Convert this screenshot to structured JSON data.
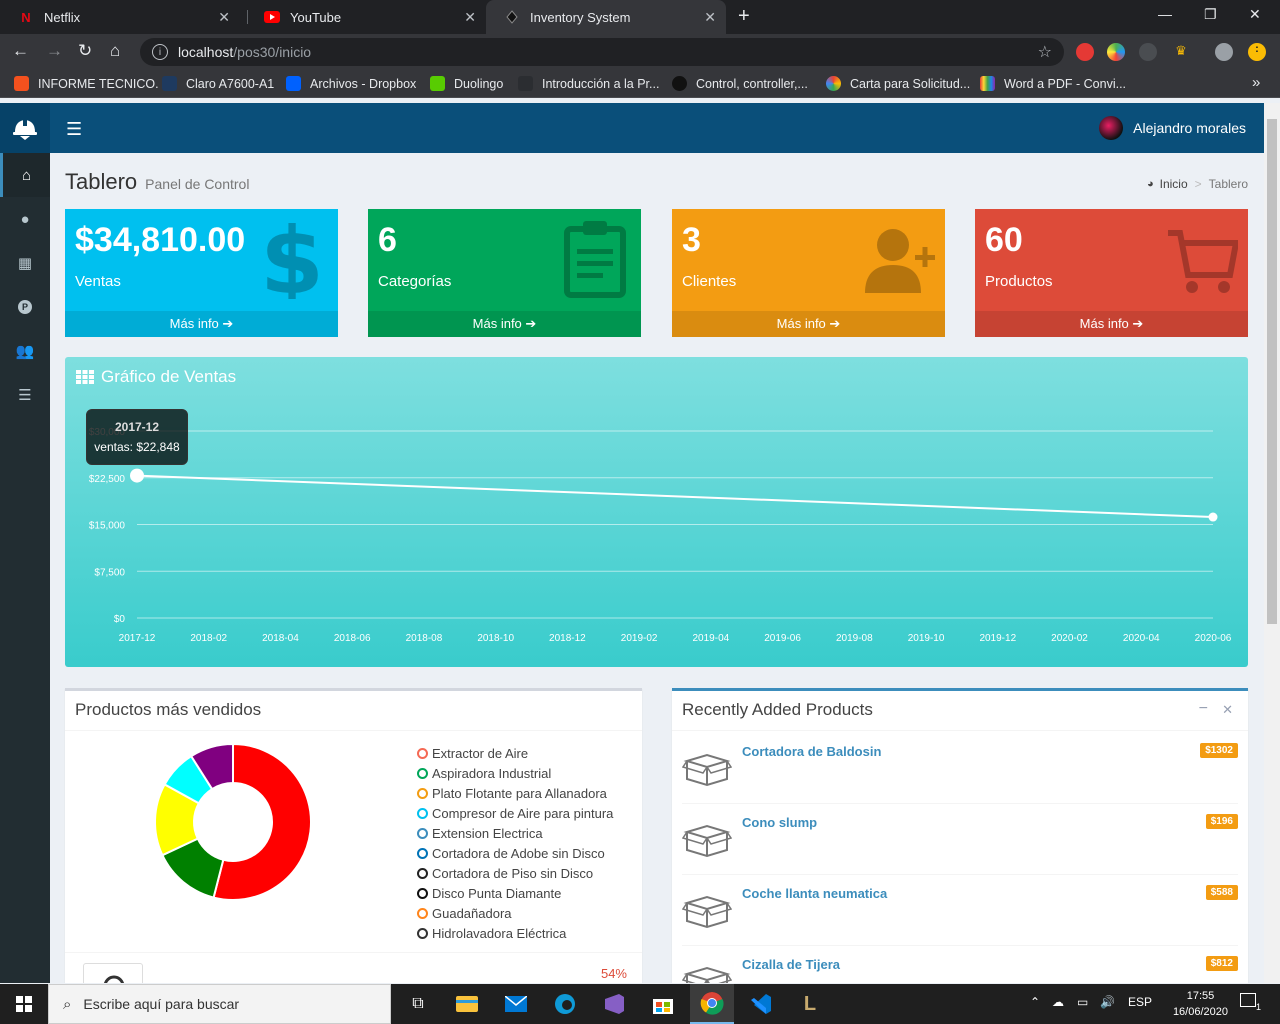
{
  "browser": {
    "tabs": [
      {
        "title": "Netflix",
        "active": false
      },
      {
        "title": "YouTube",
        "active": false
      },
      {
        "title": "Inventory System",
        "active": true
      }
    ],
    "url_host": "localhost",
    "url_path": "/pos30/inicio",
    "bookmarks": [
      "INFORME TECNICO.",
      "Claro A7600-A1",
      "Archivos - Dropbox",
      "Duolingo",
      "Introducción a la Pr...",
      "Control, controller,...",
      "Carta para Solicitud...",
      "Word a PDF - Convi..."
    ],
    "more_bookmarks": "»"
  },
  "header": {
    "user_name": "Alejandro morales"
  },
  "page": {
    "title": "Tablero",
    "subtitle": "Panel de Control",
    "breadcrumb_home": "Inicio",
    "breadcrumb_current": "Tablero"
  },
  "stats": [
    {
      "value": "$34,810.00",
      "label": "Ventas",
      "more": "Más info",
      "color": "#00c0ef"
    },
    {
      "value": "6",
      "label": "Categorías",
      "more": "Más info",
      "color": "#00a65a"
    },
    {
      "value": "3",
      "label": "Clientes",
      "more": "Más info",
      "color": "#f39c12"
    },
    {
      "value": "60",
      "label": "Productos",
      "more": "Más info",
      "color": "#dd4b39"
    }
  ],
  "sales_chart": {
    "title": "Gráfico de Ventas",
    "tooltip_title": "2017-12",
    "tooltip_value": "ventas: $22,848"
  },
  "chart_data": {
    "type": "line",
    "x": [
      "2017-12",
      "2020-06"
    ],
    "values": [
      22848,
      16200
    ],
    "xticks": [
      "2017-12",
      "2018-02",
      "2018-04",
      "2018-06",
      "2018-08",
      "2018-10",
      "2018-12",
      "2019-02",
      "2019-04",
      "2019-06",
      "2019-08",
      "2019-10",
      "2019-12",
      "2020-02",
      "2020-04",
      "2020-06"
    ],
    "yticks": [
      "$0",
      "$7,500",
      "$15,000",
      "$22,500",
      "$30,000"
    ],
    "ylim": [
      0,
      30000
    ],
    "grid": true
  },
  "top_products": {
    "title": "Productos más vendidos",
    "legend": [
      {
        "name": "Extractor de Aire",
        "color": "#f56954"
      },
      {
        "name": "Aspiradora Industrial",
        "color": "#00a65a"
      },
      {
        "name": "Plato Flotante para Allanadora",
        "color": "#f39c12"
      },
      {
        "name": "Compresor de Aire para pintura",
        "color": "#00c0ef"
      },
      {
        "name": "Extension Electrica",
        "color": "#3c8dbc"
      },
      {
        "name": "Cortadora de Adobe sin Disco",
        "color": "#0073b7"
      },
      {
        "name": "Cortadora de Piso sin Disco",
        "color": "#222222"
      },
      {
        "name": "Disco Punta Diamante",
        "color": "#111111"
      },
      {
        "name": "Guadañadora",
        "color": "#ff851b"
      },
      {
        "name": "Hidrolavadora Eléctrica",
        "color": "#333333"
      }
    ],
    "donut": [
      {
        "value": 54,
        "color": "#ff0000"
      },
      {
        "value": 14,
        "color": "#008000"
      },
      {
        "value": 15,
        "color": "#ffff00"
      },
      {
        "value": 8,
        "color": "#00ffff"
      },
      {
        "value": 9,
        "color": "#800080"
      }
    ],
    "first_percent": "54%"
  },
  "recent_products": {
    "title": "Recently Added Products",
    "items": [
      {
        "name": "Cortadora de Baldosin",
        "price": "$1302"
      },
      {
        "name": "Cono slump",
        "price": "$196"
      },
      {
        "name": "Coche llanta neumatica",
        "price": "$588"
      },
      {
        "name": "Cizalla de Tijera",
        "price": "$812"
      }
    ]
  },
  "taskbar": {
    "search_placeholder": "Escribe aquí para buscar",
    "lang": "ESP",
    "time": "17:55",
    "date": "16/06/2020",
    "notif_count": "1"
  }
}
